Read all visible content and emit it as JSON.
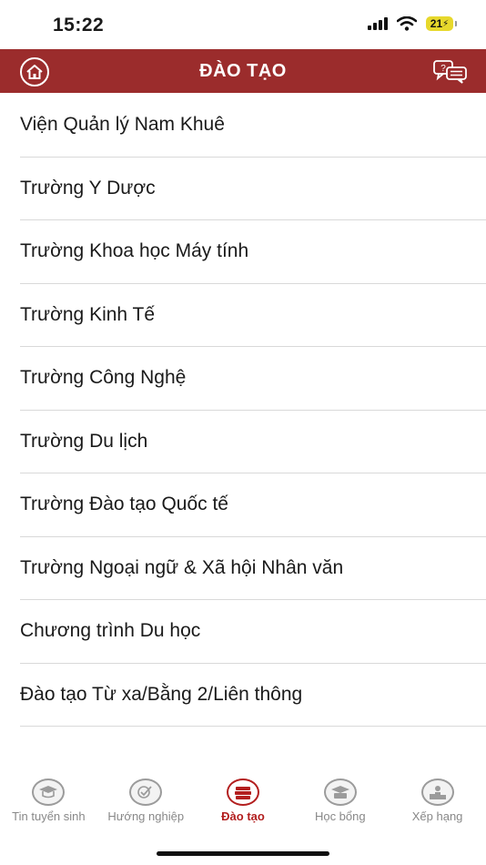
{
  "status_bar": {
    "time": "15:22",
    "battery": "21"
  },
  "header": {
    "title": "ĐÀO TẠO",
    "home_icon": "home-icon",
    "chat_icon": "chat-help-icon"
  },
  "list": {
    "items": [
      "Viện Quản lý Nam Khuê",
      "Trường Y Dược",
      "Trường Khoa học Máy tính",
      "Trường Kinh Tế",
      "Trường Công Nghệ",
      "Trường Du lịch",
      "Trường Đào tạo Quốc tế",
      "Trường Ngoại ngữ & Xã hội Nhân văn",
      "Chương trình Du học",
      "Đào tạo Từ xa/Bằng 2/Liên thông"
    ]
  },
  "tabs": [
    {
      "label": "Tin tuyển sinh",
      "icon": "graduation-cap-icon",
      "active": false
    },
    {
      "label": "Hướng nghiệp",
      "icon": "career-compass-icon",
      "active": false
    },
    {
      "label": "Đào tạo",
      "icon": "books-icon",
      "active": true
    },
    {
      "label": "Học bổng",
      "icon": "scholarship-icon",
      "active": false
    },
    {
      "label": "Xếp hạng",
      "icon": "ranking-podium-icon",
      "active": false
    }
  ],
  "colors": {
    "header_bg": "#9b2c2c",
    "active_tab": "#b31f1f",
    "inactive_tab": "#888888"
  }
}
